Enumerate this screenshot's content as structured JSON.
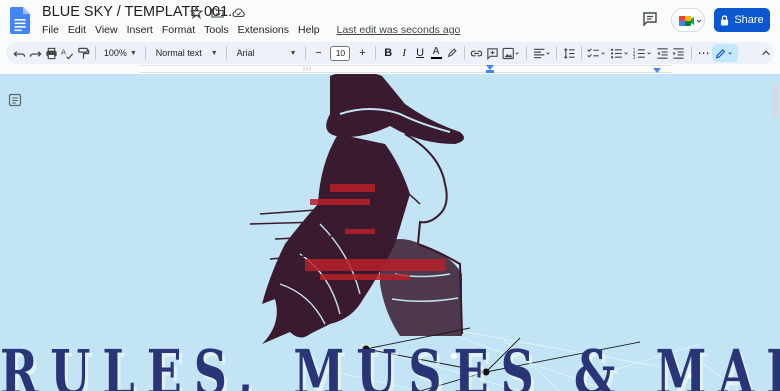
{
  "doc": {
    "title": "BLUE SKY / TEMPLATE 001.",
    "last_edit": "Last edit was seconds ago",
    "banner_text": "RULES, MUSES & MAINS"
  },
  "menu": [
    "File",
    "Edit",
    "View",
    "Insert",
    "Format",
    "Tools",
    "Extensions",
    "Help"
  ],
  "header": {
    "share_label": "Share"
  },
  "toolbar": {
    "zoom": "100%",
    "style": "Normal text",
    "font": "Arial",
    "font_size": "10",
    "minus": "−",
    "plus": "+",
    "bold": "B",
    "italic": "I",
    "underline": "U",
    "text_color": "A",
    "more": "⋯"
  },
  "colors": {
    "brand": "#0b57d0",
    "docs_icon": "#4285f4",
    "canvas_bg": "#c2e4f4",
    "banner_text": "#2a3577",
    "illustration": "#3a1a2e",
    "accent_red": "#b8202a"
  }
}
